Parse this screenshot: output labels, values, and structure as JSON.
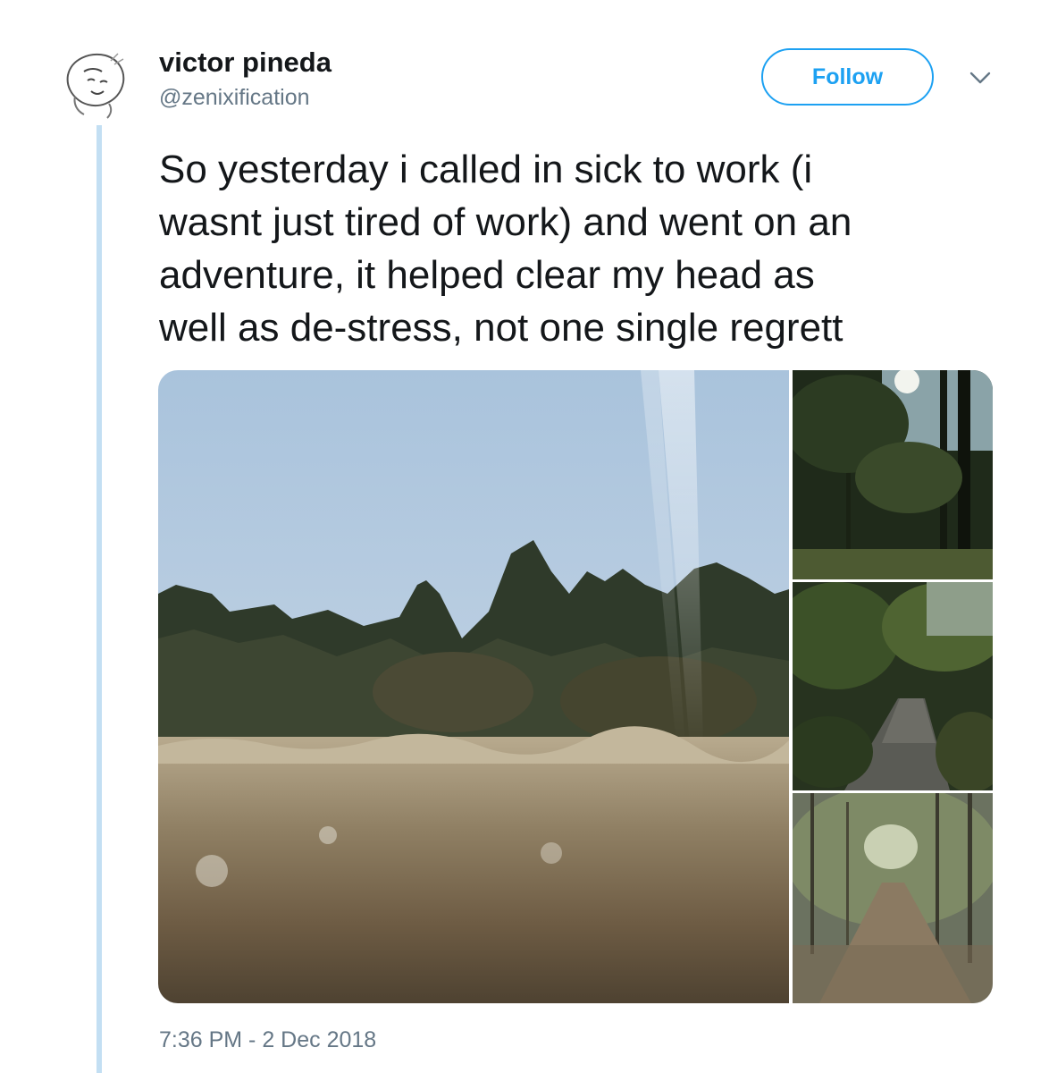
{
  "tweet": {
    "author": {
      "display_name": "victor pineda",
      "handle": "@zenixification"
    },
    "follow_label": "Follow",
    "text_lines": [
      "So yesterday i called in sick to work (i",
      "wasnt just tired of work) and went on an",
      "adventure, it helped clear my head as",
      "well as de-stress, not one single regrett"
    ],
    "timestamp": "7:36 PM - 2 Dec 2018",
    "photo_count": 4
  },
  "colors": {
    "accent": "#1da1f2",
    "thread_line": "#c3dff3",
    "secondary_text": "#657786",
    "primary_text": "#14171a"
  },
  "icons": {
    "caret": "chevron-down-icon"
  }
}
